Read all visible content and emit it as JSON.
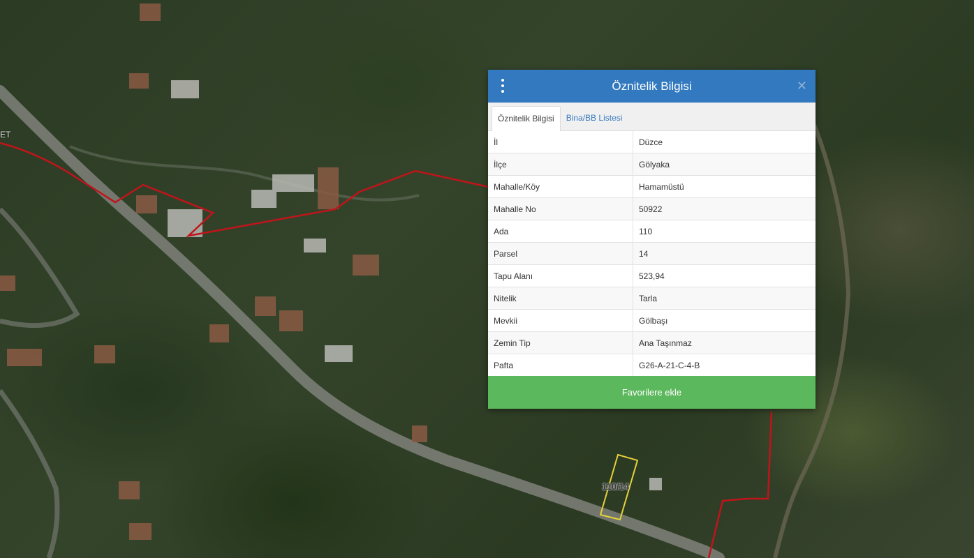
{
  "map": {
    "parcel_label": "110/14",
    "edge_label": "ET",
    "colors": {
      "boundary": "#c0141b",
      "parcel_outline": "#e6d13a",
      "road": "#8a8a84"
    }
  },
  "panel": {
    "title": "Öznitelik Bilgisi",
    "menu_icon": "vertical-ellipsis-icon",
    "close_icon": "close-icon",
    "header_color": "#3279bf",
    "tabs": [
      {
        "label": "Öznitelik Bilgisi",
        "active": true
      },
      {
        "label": "Bina/BB Listesi",
        "active": false
      }
    ],
    "rows": [
      {
        "key": "İl",
        "value": "Düzce"
      },
      {
        "key": "İlçe",
        "value": "Gölyaka"
      },
      {
        "key": "Mahalle/Köy",
        "value": "Hamamüstü"
      },
      {
        "key": "Mahalle No",
        "value": "50922"
      },
      {
        "key": "Ada",
        "value": "110"
      },
      {
        "key": "Parsel",
        "value": "14"
      },
      {
        "key": "Tapu Alanı",
        "value": "523,94"
      },
      {
        "key": "Nitelik",
        "value": "Tarla"
      },
      {
        "key": "Mevkii",
        "value": "Gölbaşı"
      },
      {
        "key": "Zemin Tip",
        "value": "Ana Taşınmaz"
      },
      {
        "key": "Pafta",
        "value": "G26-A-21-C-4-B"
      }
    ],
    "favorite_button": "Favorilere ekle",
    "favorite_color": "#5cb85c"
  }
}
